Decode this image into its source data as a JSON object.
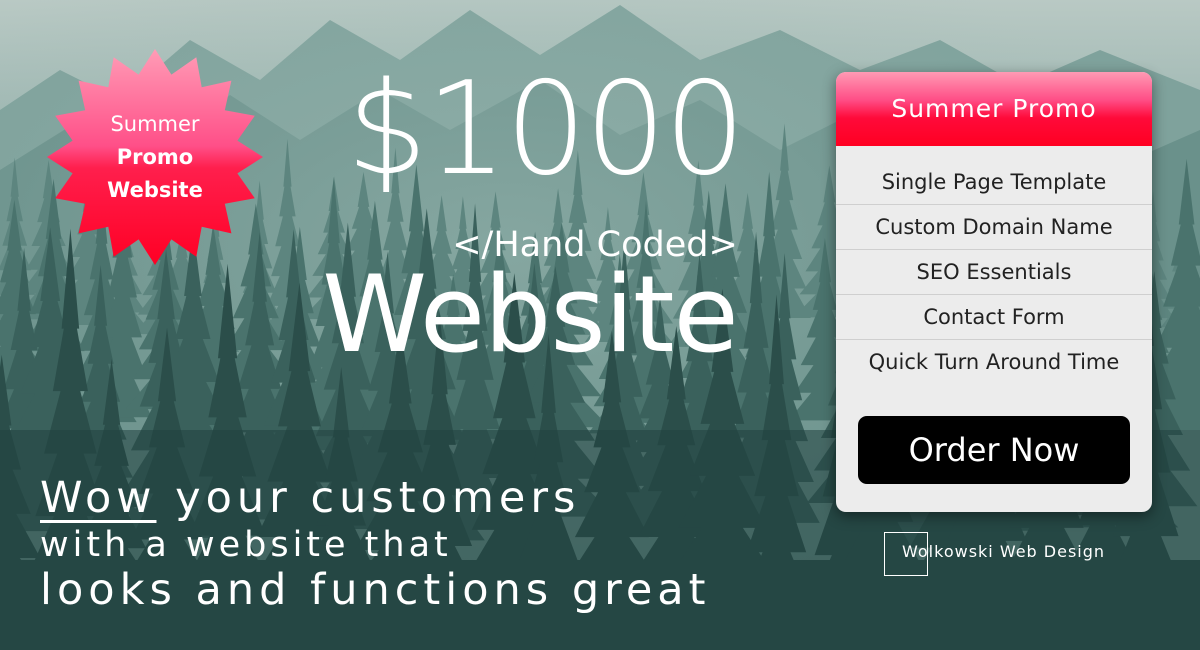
{
  "badge": {
    "line1": "Summer",
    "line2": "Promo",
    "line3": "Website"
  },
  "headline": {
    "price": "$1000",
    "subtitle": "</Hand Coded>",
    "product": "Website"
  },
  "tagline": {
    "wow": "Wow",
    "line1_rest": " your customers",
    "line2": "with a website that",
    "line3": "looks and functions great"
  },
  "promo_card": {
    "title": "Summer Promo",
    "features": [
      "Single Page Template",
      "Custom Domain Name",
      "SEO Essentials",
      "Contact Form",
      "Quick Turn Around Time"
    ],
    "order_label": "Order Now"
  },
  "logo": {
    "text": "Wolkowski Web Design"
  },
  "colors": {
    "background": "#2e5552",
    "accent_pink": "#ff4d86",
    "accent_red": "#ff0022",
    "card_bg": "#ececec",
    "button_bg": "#000000"
  }
}
